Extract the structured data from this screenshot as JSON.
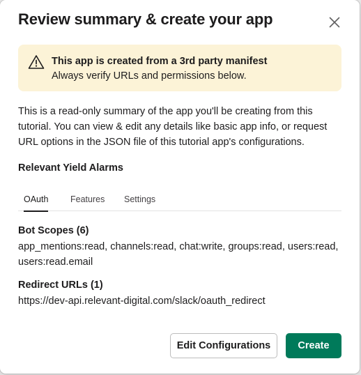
{
  "modal": {
    "title": "Review summary & create your app"
  },
  "banner": {
    "title": "This app is created from a 3rd party manifest",
    "subtitle": "Always verify URLs and permissions below.",
    "icon": "warning-icon",
    "background": "#fcf3d7"
  },
  "description": "This is a read-only summary of the app you'll be creating from this tutorial. You can view & edit any details like basic app info, or request URL options in the JSON file of this tutorial app's configurations.",
  "app_name": "Relevant Yield Alarms",
  "tabs": [
    {
      "label": "OAuth",
      "active": true
    },
    {
      "label": "Features",
      "active": false
    },
    {
      "label": "Settings",
      "active": false
    }
  ],
  "oauth": {
    "bot_scopes_title": "Bot Scopes (6)",
    "bot_scopes": "app_mentions:read, channels:read, chat:write, groups:read, users:read, users:read.email",
    "redirect_title": "Redirect URLs (1)",
    "redirect_url": "https://dev-api.relevant-digital.com/slack/oauth_redirect"
  },
  "buttons": {
    "edit_label": "Edit Configurations",
    "create_label": "Create",
    "primary_color": "#007a5a"
  }
}
